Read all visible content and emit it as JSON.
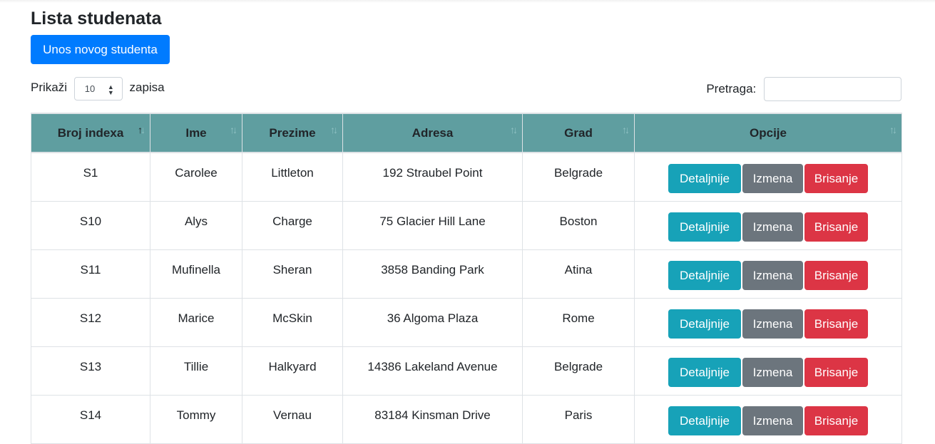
{
  "page": {
    "title": "Lista studenata",
    "add_button": "Unos novog studenta"
  },
  "length": {
    "prefix": "Prikaži",
    "value": "10",
    "suffix": "zapisa"
  },
  "search": {
    "label": "Pretraga:",
    "value": ""
  },
  "table": {
    "columns": [
      "Broj indexa",
      "Ime",
      "Prezime",
      "Adresa",
      "Grad",
      "Opcije"
    ],
    "sorted_column": "Broj indexa",
    "action_labels": {
      "details": "Detaljnije",
      "edit": "Izmena",
      "delete": "Brisanje"
    },
    "rows": [
      [
        "S1",
        "Carolee",
        "Littleton",
        "192 Straubel Point",
        "Belgrade"
      ],
      [
        "S10",
        "Alys",
        "Charge",
        "75 Glacier Hill Lane",
        "Boston"
      ],
      [
        "S11",
        "Mufinella",
        "Sheran",
        "3858 Banding Park",
        "Atina"
      ],
      [
        "S12",
        "Marice",
        "McSkin",
        "36 Algoma Plaza",
        "Rome"
      ],
      [
        "S13",
        "Tillie",
        "Halkyard",
        "14386 Lakeland Avenue",
        "Belgrade"
      ],
      [
        "S14",
        "Tommy",
        "Vernau",
        "83184 Kinsman Drive",
        "Paris"
      ]
    ]
  },
  "colors": {
    "header_bg": "#5f9ea0",
    "primary": "#007bff",
    "info": "#17a2b8",
    "secondary": "#6c757d",
    "danger": "#dc3545"
  },
  "icons": {
    "sort": "sort-arrows-icon",
    "select_caret": "up-down-caret-icon"
  }
}
